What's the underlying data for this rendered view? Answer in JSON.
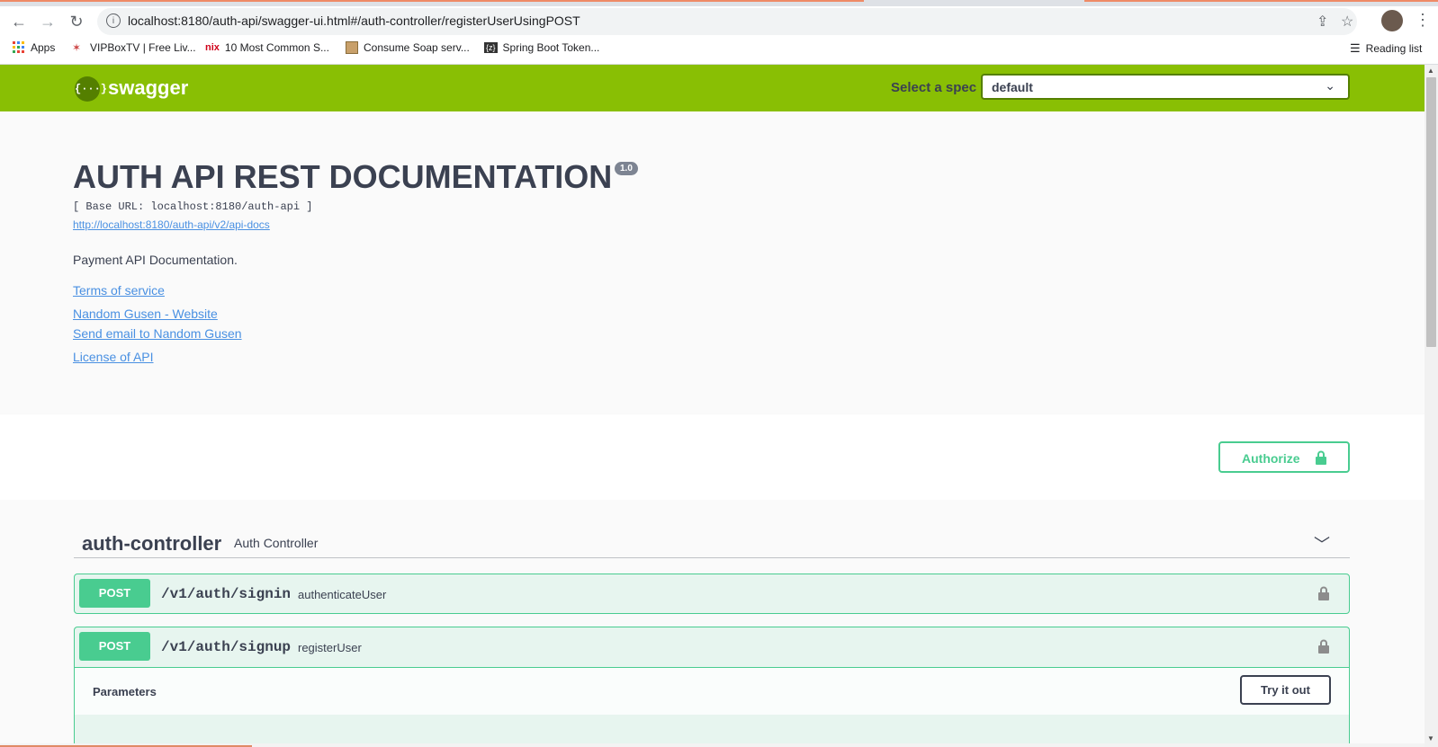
{
  "browser": {
    "url": "localhost:8180/auth-api/swagger-ui.html#/auth-controller/registerUserUsingPOST",
    "bookmarks": [
      {
        "label": "Apps",
        "icon": "apps-grid-icon"
      },
      {
        "label": "VIPBoxTV | Free Liv...",
        "icon": "vipbox-icon"
      },
      {
        "label": "10 Most Common S...",
        "icon": "nix-icon",
        "icon_text": "nix"
      },
      {
        "label": "Consume Soap serv...",
        "icon": "page-favicon-icon"
      },
      {
        "label": "Spring Boot Token...",
        "icon": "z-favicon-icon",
        "icon_text": "{z}"
      }
    ],
    "reading_list": "Reading list"
  },
  "topbar": {
    "logo_glyph": "{···}",
    "logo_text": "swagger",
    "spec_label": "Select a spec",
    "spec_value": "default"
  },
  "info": {
    "title": "AUTH API REST DOCUMENTATION",
    "version": "1.0",
    "base_url": "[ Base URL: localhost:8180/auth-api ]",
    "api_docs_link": "http://localhost:8180/auth-api/v2/api-docs",
    "description": "Payment API Documentation.",
    "links": [
      "Terms of service",
      "Nandom Gusen - Website",
      "Send email to Nandom Gusen",
      "License of API"
    ]
  },
  "authorize_label": "Authorize",
  "tag": {
    "name": "auth-controller",
    "description": "Auth Controller"
  },
  "operations": [
    {
      "method": "POST",
      "path": "/v1/auth/signin",
      "summary": "authenticateUser"
    },
    {
      "method": "POST",
      "path": "/v1/auth/signup",
      "summary": "registerUser"
    }
  ],
  "parameters_label": "Parameters",
  "try_label": "Try it out",
  "colors": {
    "topbar": "#89bf04",
    "post": "#49cc90",
    "link": "#4990e2",
    "text": "#3b4151"
  }
}
